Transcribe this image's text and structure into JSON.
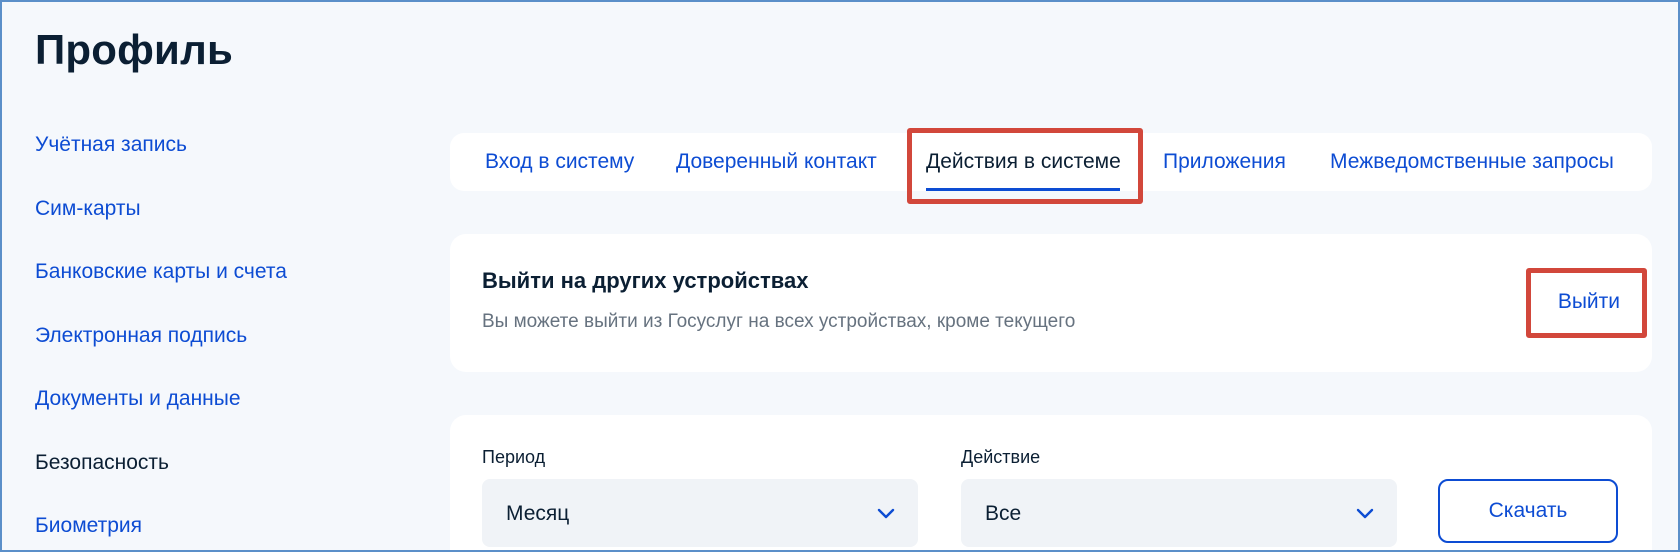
{
  "page": {
    "title": "Профиль"
  },
  "sidebar": {
    "items": [
      {
        "label": "Учётная запись"
      },
      {
        "label": "Сим-карты"
      },
      {
        "label": "Банковские карты и счета"
      },
      {
        "label": "Электронная подпись"
      },
      {
        "label": "Документы и данные"
      },
      {
        "label": "Безопасность",
        "active": true
      },
      {
        "label": "Биометрия"
      }
    ]
  },
  "tabs": [
    {
      "label": "Вход в систему"
    },
    {
      "label": "Доверенный контакт"
    },
    {
      "label": "Действия в системе",
      "active": true
    },
    {
      "label": "Приложения"
    },
    {
      "label": "Межведомственные запросы"
    }
  ],
  "logout_card": {
    "title": "Выйти на других устройствах",
    "description": "Вы можете выйти из Госуслуг на всех устройствах, кроме текущего",
    "action_label": "Выйти"
  },
  "filters": {
    "period": {
      "label": "Период",
      "value": "Месяц"
    },
    "action": {
      "label": "Действие",
      "value": "Все"
    },
    "download_label": "Скачать"
  },
  "colors": {
    "accent": "#0d4cd3",
    "text": "#0b1f33",
    "muted": "#66727f",
    "highlight": "#d2473b",
    "background": "#f5f8fc"
  },
  "icons": {
    "select_chevron": "chevron-down-icon"
  }
}
